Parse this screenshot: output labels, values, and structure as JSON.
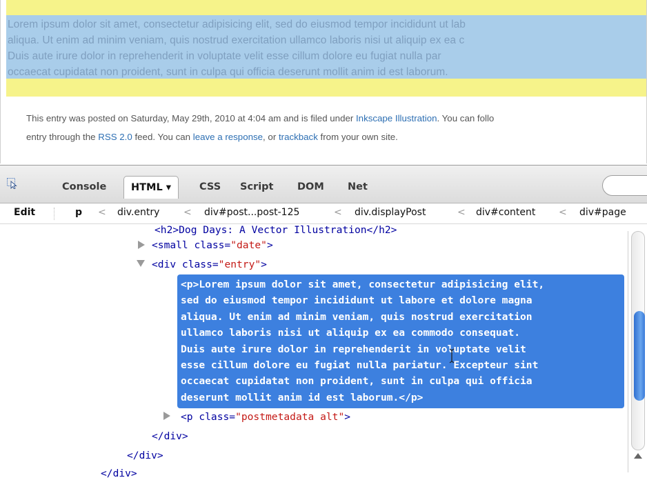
{
  "webpage": {
    "lorem_lines": [
      "Lorem ipsum dolor sit amet, consectetur adipisicing elit, sed do eiusmod tempor incididunt ut lab",
      "aliqua. Ut enim ad minim veniam, quis nostrud exercitation ullamco laboris nisi ut aliquip ex ea c",
      "Duis aute irure dolor in reprehenderit in voluptate velit esse cillum dolore eu fugiat nulla par",
      "occaecat cupidatat non proident, sunt in culpa qui officia deserunt mollit anim id est laborum."
    ],
    "meta": {
      "line1_prefix": "This entry was posted on Saturday, May 29th, 2010 at 4:04 am and is filed under ",
      "category_link": "Inkscape Illustration",
      "line1_suffix": ". You can follo",
      "line2_prefix": "entry through the ",
      "rss_link": "RSS 2.0",
      "line2_mid1": " feed. You can ",
      "response_link": "leave a response",
      "line2_mid2": ", or ",
      "trackback_link": "trackback",
      "line2_suffix": " from your own site."
    }
  },
  "firebug": {
    "tabs": [
      "Console",
      "HTML",
      "CSS",
      "Script",
      "DOM",
      "Net"
    ],
    "html_tab_arrow": "▾",
    "edit_label": "Edit",
    "breadcrumb": [
      "p",
      "div.entry",
      "div#post...post-125",
      "div.displayPost",
      "div#content",
      "div#page"
    ],
    "breadcrumb_separator": "<"
  },
  "tree": {
    "h2_line": "<h2>Dog Days: A Vector Illustration</h2>",
    "small_open": "<small class=",
    "small_class": "\"date\"",
    "div_open": "<div class=",
    "div_class": "\"entry\"",
    "selected_lines": [
      "<p>Lorem ipsum dolor sit amet, consectetur adipisicing elit,",
      "sed do eiusmod tempor incididunt ut labore et dolore magna",
      "aliqua. Ut enim ad minim veniam, quis nostrud exercitation",
      "ullamco laboris nisi ut aliquip ex ea commodo consequat.",
      "Duis aute irure dolor in reprehenderit in voluptate velit",
      "esse cillum dolore eu fugiat nulla pariatur. Excepteur sint",
      "occaecat cupidatat non proident, sunt in culpa qui officia",
      "deserunt mollit anim id est laborum.</p>"
    ],
    "p_meta_open": "<p class=",
    "p_meta_class": "\"postmetadata alt\"",
    "close_div": "</div>",
    "tag_end": ">"
  },
  "colors": {
    "selection": "#3d80df",
    "page_highlight_yellow": "#f6f38a",
    "page_highlight_blue": "#a9cdea",
    "link": "#2d6fb3",
    "attr_value": "#c41a16",
    "tag": "#0000a0"
  }
}
